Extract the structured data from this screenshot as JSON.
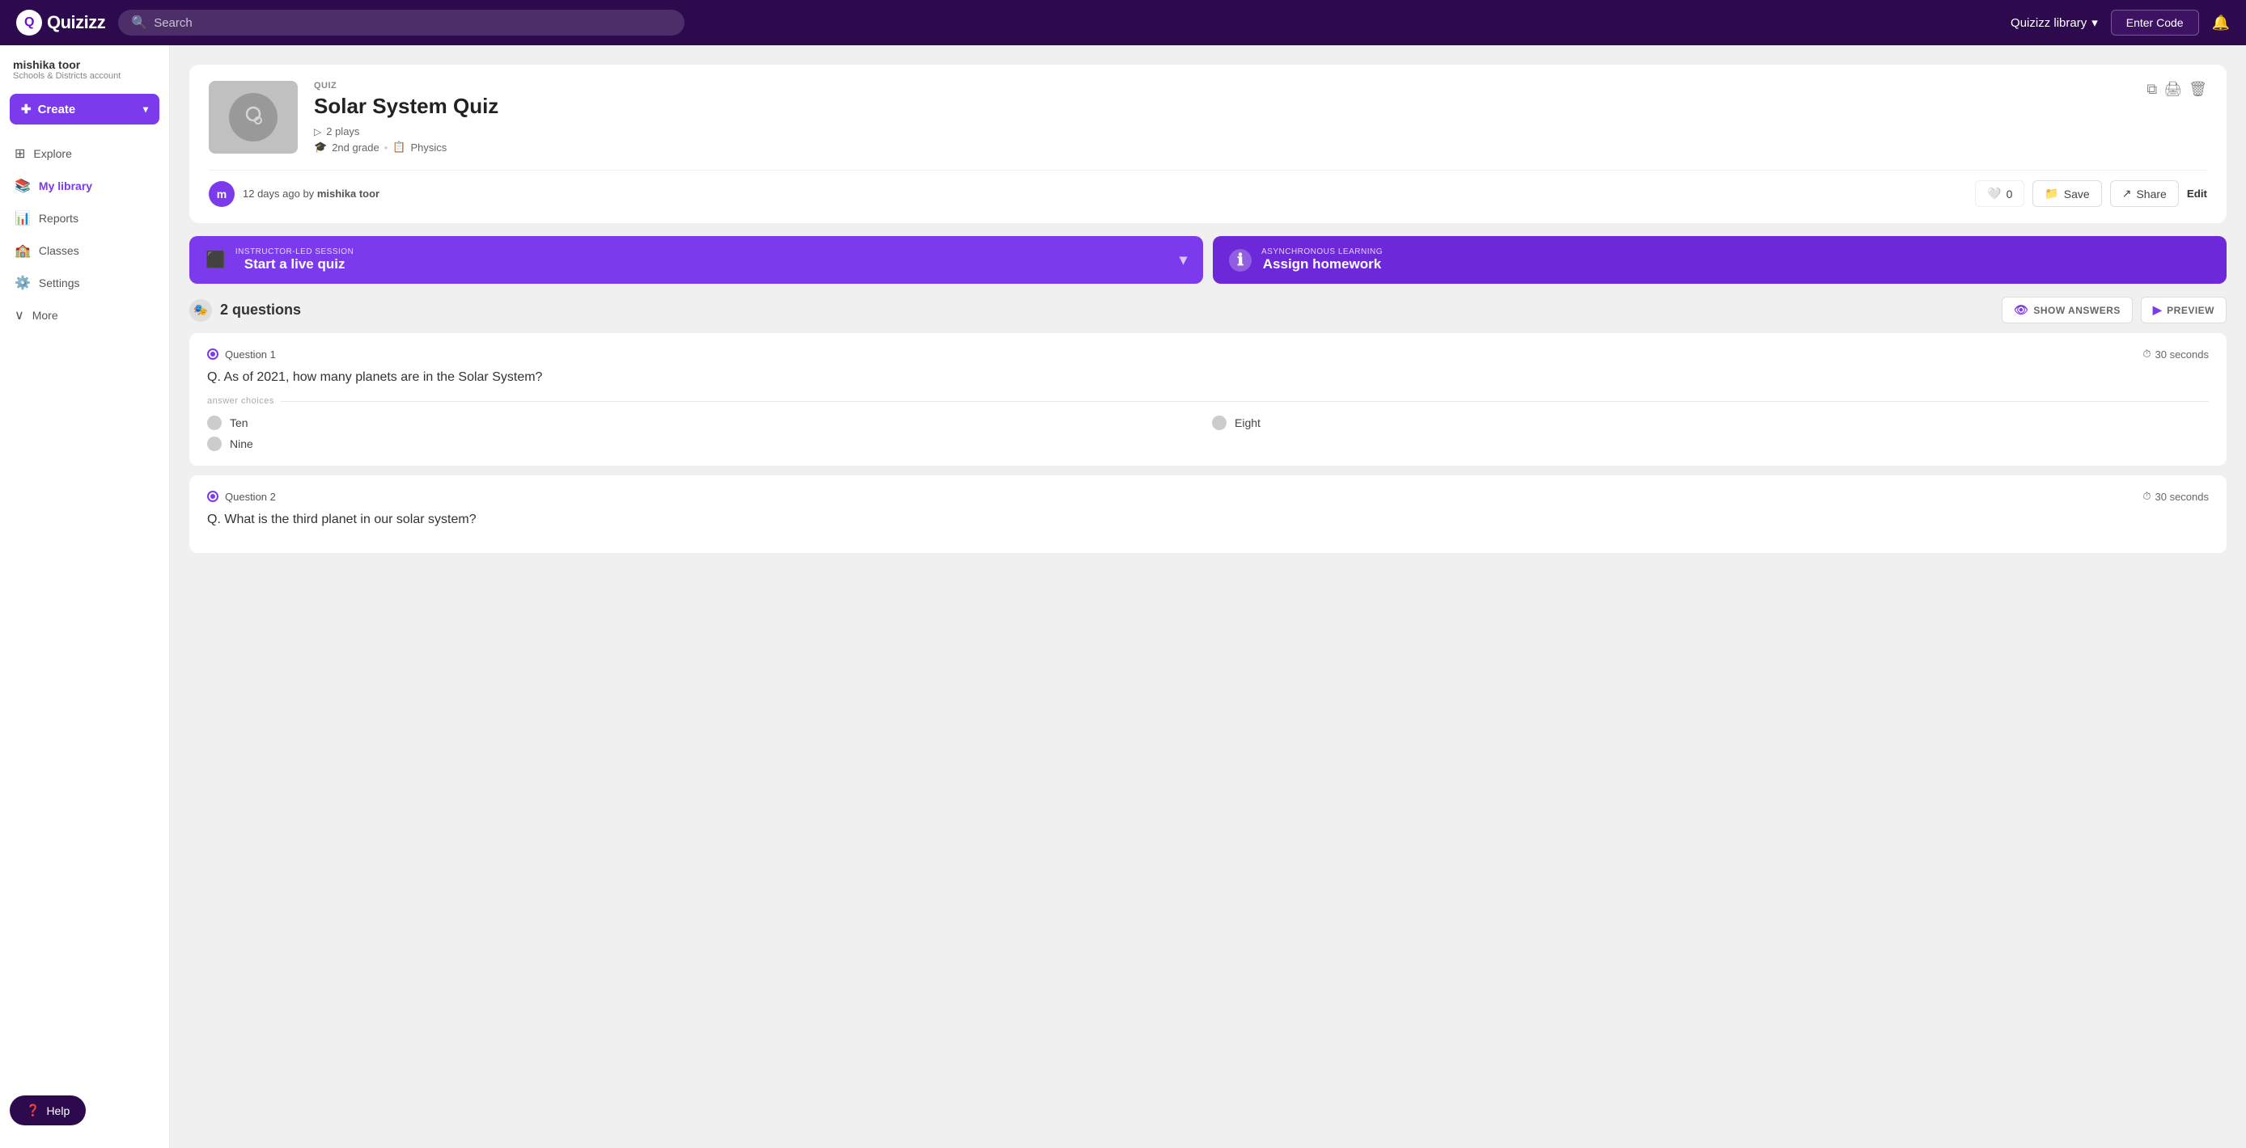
{
  "header": {
    "logo_text": "Quizizz",
    "search_placeholder": "Search",
    "library_label": "Quizizz library",
    "enter_code_label": "Enter Code"
  },
  "sidebar": {
    "user_name": "mishika toor",
    "user_sub": "Schools & Districts account",
    "create_label": "Create",
    "nav_items": [
      {
        "id": "explore",
        "label": "Explore",
        "icon": "🧭"
      },
      {
        "id": "my-library",
        "label": "My library",
        "icon": "📚",
        "active": true
      },
      {
        "id": "reports",
        "label": "Reports",
        "icon": "📊"
      },
      {
        "id": "classes",
        "label": "Classes",
        "icon": "🏫"
      },
      {
        "id": "settings",
        "label": "Settings",
        "icon": "⚙️"
      },
      {
        "id": "more",
        "label": "More",
        "icon": "∨"
      }
    ],
    "help_label": "Help"
  },
  "quiz": {
    "type_label": "QUIZ",
    "title": "Solar System Quiz",
    "plays": "2 plays",
    "grade": "2nd grade",
    "subject": "Physics",
    "author_time": "12 days ago by",
    "author_name": "mishika toor",
    "author_initial": "m",
    "like_count": "0",
    "save_label": "Save",
    "share_label": "Share",
    "edit_label": "Edit"
  },
  "actions": {
    "live_session_label": "INSTRUCTOR-LED SESSION",
    "live_title": "Start a live quiz",
    "async_label": "ASYNCHRONOUS LEARNING",
    "async_title": "Assign homework"
  },
  "questions": {
    "count_label": "2 questions",
    "show_answers_label": "SHOW ANSWERS",
    "preview_label": "PREVIEW",
    "items": [
      {
        "number": "Question 1",
        "timer": "30 seconds",
        "text": "Q. As of 2021, how many planets are in the Solar System?",
        "answers_label": "answer choices",
        "choices": [
          {
            "text": "Ten"
          },
          {
            "text": "Eight"
          },
          {
            "text": "Nine"
          }
        ]
      },
      {
        "number": "Question 2",
        "timer": "30 seconds",
        "text": "Q. What is the third planet in our solar system?"
      }
    ]
  }
}
